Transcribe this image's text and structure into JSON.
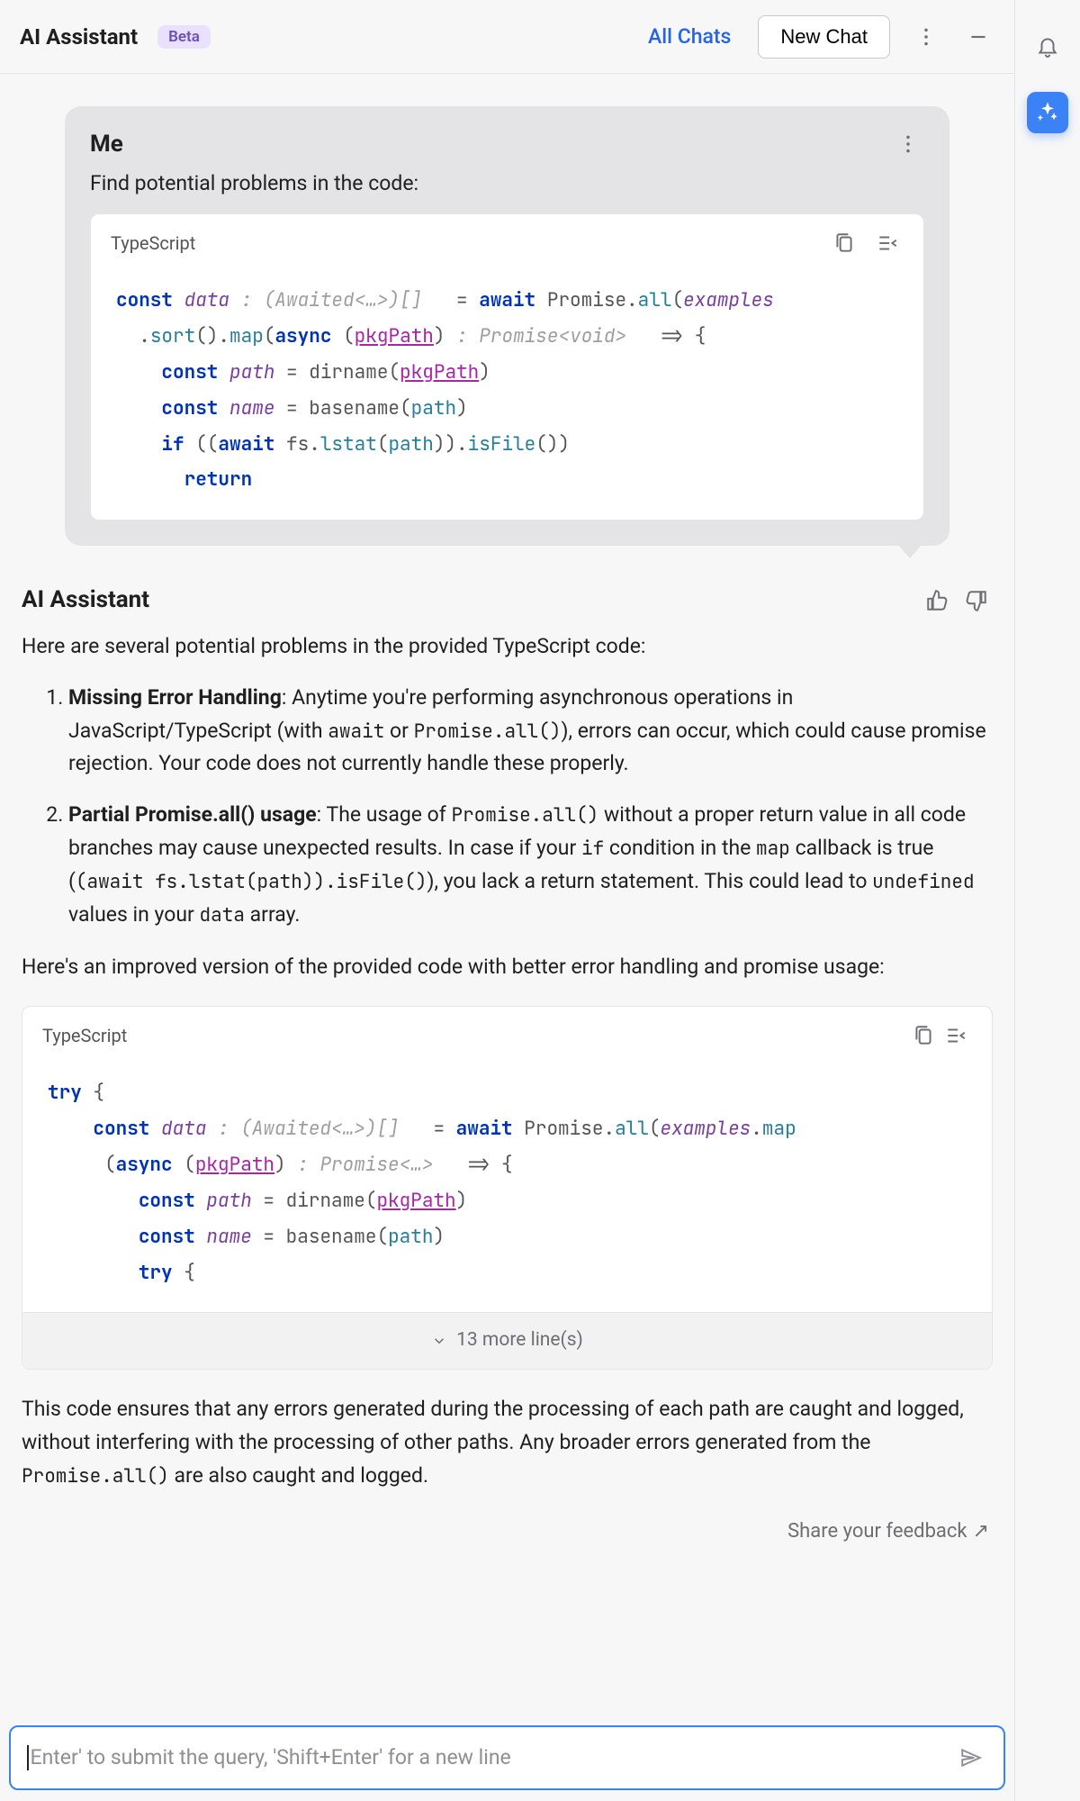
{
  "topbar": {
    "title": "AI Assistant",
    "badge": "Beta",
    "all_chats": "All Chats",
    "new_chat": "New Chat"
  },
  "user_msg": {
    "name": "Me",
    "text": "Find potential problems in the code:",
    "lang": "TypeScript"
  },
  "code1_tokens": [
    [
      [
        "const",
        "kw"
      ],
      [
        " ",
        "pn"
      ],
      [
        "data",
        "fnv"
      ],
      [
        " ",
        "pn"
      ],
      [
        ": (Awaited<…>)[]",
        "ht"
      ],
      [
        "   = ",
        "pn"
      ],
      [
        "await",
        "kw"
      ],
      [
        " ",
        "pn"
      ],
      [
        "Promise",
        "pn"
      ],
      [
        ".",
        "pn"
      ],
      [
        "all",
        "tp"
      ],
      [
        "(",
        "pn"
      ],
      [
        "examples",
        "fnv"
      ]
    ],
    [
      [
        "  .",
        "pn"
      ],
      [
        "sort",
        "tp"
      ],
      [
        "().",
        "pn"
      ],
      [
        "map",
        "tp"
      ],
      [
        "(",
        "pn"
      ],
      [
        "async",
        "kw"
      ],
      [
        " ",
        "pn"
      ],
      [
        "(",
        "pn"
      ],
      [
        "pkgPath",
        "vr udl"
      ],
      [
        ")",
        "pn"
      ],
      [
        " ",
        "pn"
      ],
      [
        ": Promise<void>",
        "ht"
      ],
      [
        "   => {",
        "pn"
      ]
    ],
    [
      [
        "    ",
        "pn"
      ],
      [
        "const",
        "kw"
      ],
      [
        " ",
        "pn"
      ],
      [
        "path",
        "fnv"
      ],
      [
        " = ",
        "pn"
      ],
      [
        "dirname",
        "pn"
      ],
      [
        "(",
        "pn"
      ],
      [
        "pkgPath",
        "vr udl"
      ],
      [
        ")",
        "pn"
      ]
    ],
    [
      [
        "    ",
        "pn"
      ],
      [
        "const",
        "kw"
      ],
      [
        " ",
        "pn"
      ],
      [
        "name",
        "fnv"
      ],
      [
        " = ",
        "pn"
      ],
      [
        "basename",
        "pn"
      ],
      [
        "(",
        "pn"
      ],
      [
        "path",
        "tp"
      ],
      [
        ")",
        "pn"
      ]
    ],
    [
      [
        "    ",
        "pn"
      ],
      [
        "if",
        "kw"
      ],
      [
        " ((",
        "pn"
      ],
      [
        "await",
        "kw"
      ],
      [
        " fs.",
        "pn"
      ],
      [
        "lstat",
        "tp"
      ],
      [
        "(",
        "pn"
      ],
      [
        "path",
        "tp"
      ],
      [
        ")).",
        "pn"
      ],
      [
        "isFile",
        "tp"
      ],
      [
        "())",
        "pn"
      ]
    ],
    [
      [
        "      ",
        "pn"
      ],
      [
        "return",
        "kw"
      ]
    ]
  ],
  "assistant": {
    "name": "AI Assistant",
    "intro": "Here are several potential problems in the provided TypeScript code:",
    "p1_title": "Missing Error Handling",
    "p1_body_a": ": Anytime you're performing asynchronous operations in JavaScript/TypeScript (with ",
    "p1_mono_a": "await",
    "p1_body_b": " or ",
    "p1_mono_b": "Promise.all()",
    "p1_body_c": "), errors can occur, which could cause promise rejection. Your code does not currently handle these properly.",
    "p2_title": "Partial Promise.all() usage",
    "p2_body_a": ": The usage of ",
    "p2_mono_a": "Promise.all()",
    "p2_body_b": " without a proper return value in all code branches may cause unexpected results. In case if your ",
    "p2_mono_b": "if",
    "p2_body_c": " condition in the ",
    "p2_mono_c": "map",
    "p2_body_d": " callback is true (",
    "p2_mono_d": "(await fs.lstat(path)).isFile()",
    "p2_body_e": "), you lack a return statement. This could lead to ",
    "p2_mono_e": "undefined",
    "p2_body_f": " values in your ",
    "p2_mono_f": "data",
    "p2_body_g": " array.",
    "improved": "Here's an improved version of the provided code with better error handling and promise usage:",
    "lang": "TypeScript",
    "more_lines": "13 more line(s)",
    "outro_a": "This code ensures that any errors generated during the processing of each path are caught and logged, without interfering with the processing of other paths. Any broader errors generated from the ",
    "outro_mono": "Promise.all()",
    "outro_b": " are also caught and logged."
  },
  "code2_tokens": [
    [
      [
        "try",
        "kw"
      ],
      [
        " {",
        "pn"
      ]
    ],
    [
      [
        "    ",
        "pn"
      ],
      [
        "const",
        "kw"
      ],
      [
        " ",
        "pn"
      ],
      [
        "data",
        "fnv"
      ],
      [
        " ",
        "pn"
      ],
      [
        ": (Awaited<…>)[]",
        "ht"
      ],
      [
        "   = ",
        "pn"
      ],
      [
        "await",
        "kw"
      ],
      [
        " ",
        "pn"
      ],
      [
        "Promise",
        "pn"
      ],
      [
        ".",
        "pn"
      ],
      [
        "all",
        "tp"
      ],
      [
        "(",
        "pn"
      ],
      [
        "examples",
        "fnv"
      ],
      [
        ".",
        "pn"
      ],
      [
        "map",
        "tp"
      ]
    ],
    [
      [
        "     (",
        "pn"
      ],
      [
        "async",
        "kw"
      ],
      [
        " ",
        "pn"
      ],
      [
        "(",
        "pn"
      ],
      [
        "pkgPath",
        "vr udl"
      ],
      [
        ")",
        "pn"
      ],
      [
        " ",
        "pn"
      ],
      [
        ": Promise<…>",
        "ht"
      ],
      [
        "   => {",
        "pn"
      ]
    ],
    [
      [
        "        ",
        "pn"
      ],
      [
        "const",
        "kw"
      ],
      [
        " ",
        "pn"
      ],
      [
        "path",
        "fnv"
      ],
      [
        " = ",
        "pn"
      ],
      [
        "dirname",
        "pn"
      ],
      [
        "(",
        "pn"
      ],
      [
        "pkgPath",
        "vr udl"
      ],
      [
        ")",
        "pn"
      ]
    ],
    [
      [
        "        ",
        "pn"
      ],
      [
        "const",
        "kw"
      ],
      [
        " ",
        "pn"
      ],
      [
        "name",
        "fnv"
      ],
      [
        " = ",
        "pn"
      ],
      [
        "basename",
        "pn"
      ],
      [
        "(",
        "pn"
      ],
      [
        "path",
        "tp"
      ],
      [
        ")",
        "pn"
      ]
    ],
    [
      [
        "        ",
        "pn"
      ],
      [
        "try",
        "kw"
      ],
      [
        " {",
        "pn"
      ]
    ]
  ],
  "feedback": {
    "label": "Share your feedback",
    "arrow": "↗"
  },
  "input": {
    "placeholder": "Enter' to submit the query, 'Shift+Enter' for a new line"
  }
}
